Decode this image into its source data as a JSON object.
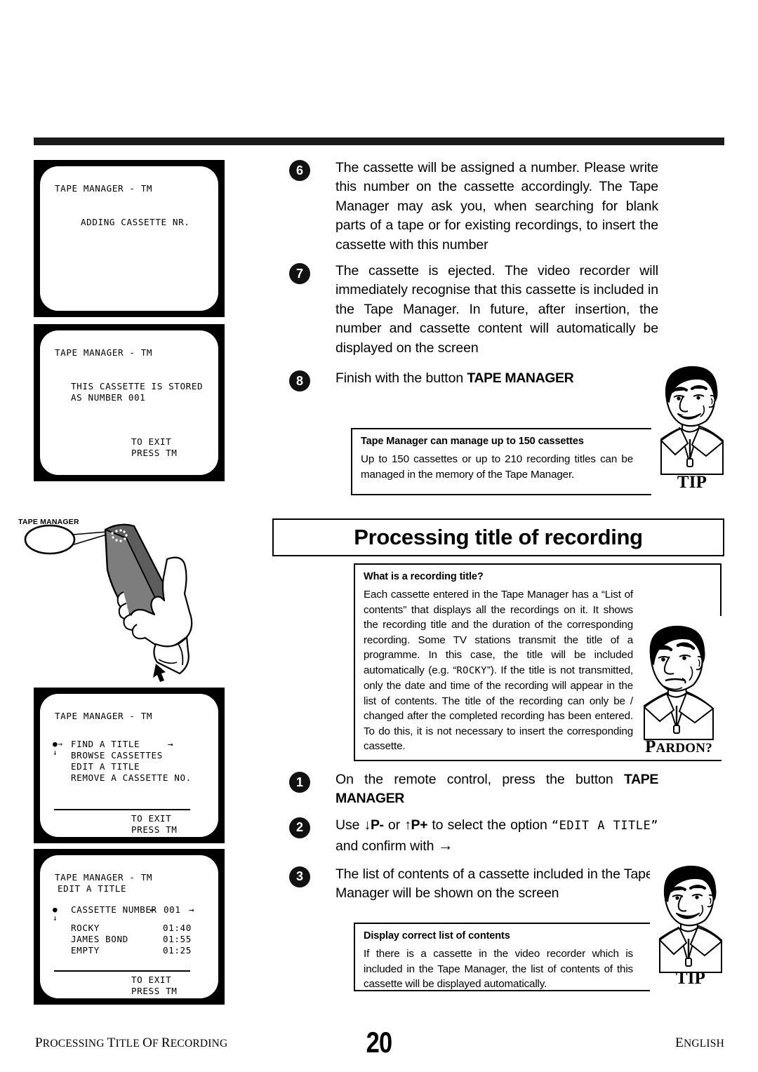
{
  "document": {
    "page_number": "20",
    "footer_left": "Processing title of recording",
    "footer_right": "English"
  },
  "heading": "Processing title of recording",
  "remote": {
    "button_label": "TAPE MANAGER"
  },
  "screens": [
    {
      "id": "adding-cassette",
      "title": "TAPE MANAGER - TM",
      "body": "ADDING CASSETTE NR."
    },
    {
      "id": "cassette-stored",
      "title": "TAPE MANAGER - TM",
      "body": "THIS CASSETTE IS STORED\nAS NUMBER 001",
      "exit": "TO EXIT\nPRESS TM"
    },
    {
      "id": "tape-manager-menu",
      "title": "TAPE MANAGER - TM",
      "menu": [
        "FIND A TITLE",
        "BROWSE CASSETTES",
        "EDIT A TITLE",
        "REMOVE A CASSETTE NO."
      ],
      "menu_right_arrow": "→",
      "cursor_marks": "●→\n↓",
      "exit": "TO EXIT\nPRESS TM"
    },
    {
      "id": "edit-a-title",
      "title": "TAPE MANAGER - TM",
      "subtitle": "EDIT A TITLE",
      "cursor_marks": "●\n↓",
      "field_label": "CASSETTE NUMBER",
      "field_left_arrow": "←",
      "field_value": "001",
      "field_right_arrow": "→",
      "contents": [
        {
          "title": "ROCKY",
          "duration": "01:40"
        },
        {
          "title": "JAMES BOND",
          "duration": "01:55"
        },
        {
          "title": "EMPTY",
          "duration": "01:25"
        }
      ],
      "exit": "TO EXIT\nPRESS TM"
    }
  ],
  "steps_top": [
    {
      "number": "6",
      "text": "The cassette will be assigned a number. Please write this number on the cassette accordingly. The Tape Manager may ask you, when searching for blank parts of a tape or for existing recordings, to insert the cassette with this number"
    },
    {
      "number": "7",
      "text": "The cassette is ejected. The video recorder will immediately recognise that this cassette is included in the Tape Manager. In future, after insertion, the number and cassette content will automatically be displayed on the screen"
    },
    {
      "number": "8",
      "text_prefix": "Finish with the button ",
      "text_bold": "TAPE MANAGER"
    }
  ],
  "steps_bottom": [
    {
      "number": "1",
      "text_prefix": "On the remote control, press the button ",
      "text_bold": "TAPE MANAGER"
    },
    {
      "number": "2",
      "seg_a": "Use ",
      "seg_b": "↓P-",
      "seg_c": " or ",
      "seg_d": "↑P+",
      "seg_e": " to select the option ",
      "seg_f": "“EDIT A TITLE”",
      "seg_g": " and confirm with ",
      "seg_h": "→"
    },
    {
      "number": "3",
      "text": "The list of contents of a cassette included in the Tape Manager will be shown on the screen"
    }
  ],
  "callouts": {
    "tip_capacity": {
      "mascot": "TIP",
      "mascot_first": "T",
      "mascot_rest": "IP",
      "head": "Tape Manager can manage up to 150 cassettes",
      "body": "Up to 150 cassettes or up to 210 recording titles can be managed in the memory of the Tape Manager."
    },
    "pardon_title": {
      "mascot_first": "P",
      "mascot_rest": "ARDON?",
      "head": "What is a recording title?",
      "body_a": "Each cassette entered in the Tape Manager has a “List of contents” that displays all the recordings on it. It shows the recording title and the duration of the corresponding recording. Some TV stations transmit the title of a programme. In this case, the title will be included automatically (e.g. “",
      "body_mono": "ROCKY",
      "body_b": "”). If the title is not transmitted, only the date and time of the recording will appear in the list of contents. The title of the recording can only be / changed after the completed recording has been entered. To do this, it is not necessary to insert the corresponding cassette."
    },
    "tip_contents": {
      "mascot_first": "T",
      "mascot_rest": "IP",
      "head": "Display correct list of contents",
      "body": "If there is a cassette in the video recorder which is included in the Tape Manager, the list of contents of this cassette will be displayed automatically."
    }
  }
}
